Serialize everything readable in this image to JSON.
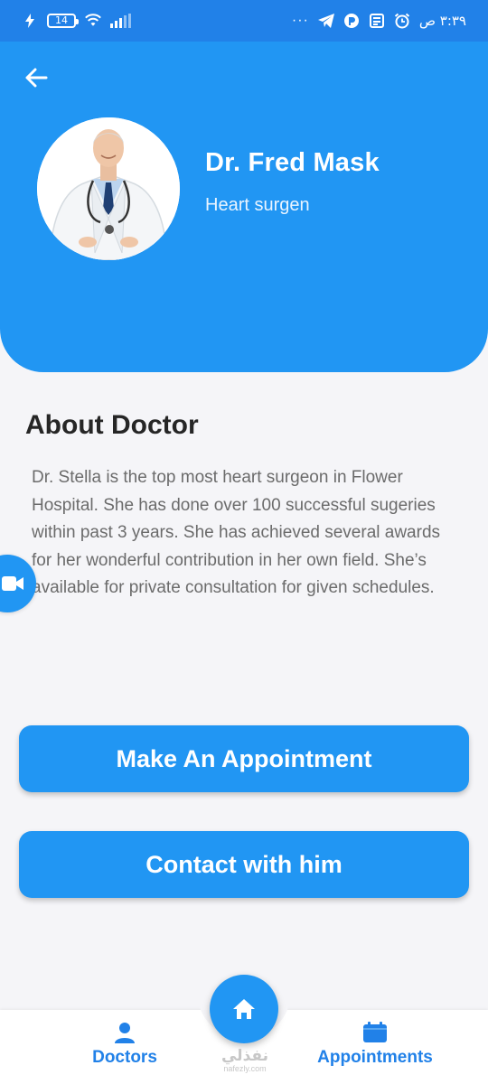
{
  "status_bar": {
    "time": "٣:٣٩ ص",
    "battery": "14",
    "more": "···"
  },
  "header": {
    "back_icon": "arrow-left-icon",
    "doctor_name": "Dr. Fred Mask",
    "specialty": "Heart surgen"
  },
  "about": {
    "title": "About Doctor",
    "text": "Dr. Stella is the top most heart surgeon in Flower Hospital. She has done over 100 successful sugeries within past 3 years. She has achieved several awards for her wonderful contribution in her own field. She’s available for private consultation for given schedules."
  },
  "buttons": {
    "appointment": "Make An Appointment",
    "contact": "Contact with him"
  },
  "bottom_nav": {
    "doctors": "Doctors",
    "appointments": "Appointments",
    "home_icon": "home-icon"
  },
  "watermark": {
    "arabic": "نفذلي",
    "latin": "nafezly.com"
  },
  "colors": {
    "primary": "#2196f3",
    "status_bar": "#2181e8",
    "background": "#f5f5f8",
    "title_text": "#262626",
    "body_text": "#6b6b6b"
  }
}
